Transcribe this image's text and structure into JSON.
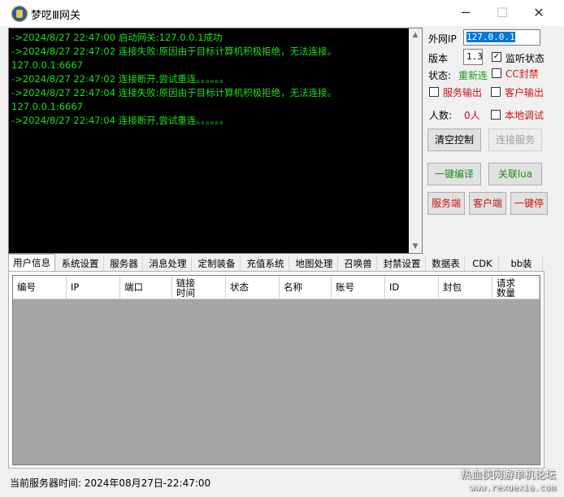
{
  "window": {
    "title": "梦呓Ⅲ网关",
    "minimize": "─",
    "maximize": "☐",
    "close": "✕"
  },
  "log": [
    "->2024/8/27 22:47:00   启动网关:127.0.0.1成功",
    "->2024/8/27 22:47:02   连接失败:原因由于目标计算机积极拒绝，无法连接。",
    "127.0.0.1:6667",
    "->2024/8/27 22:47:02   连接断开,尝试重连。。。。。。",
    "->2024/8/27 22:47:04   连接失败:原因由于目标计算机积极拒绝，无法连接。",
    "127.0.0.1:6667",
    "->2024/8/27 22:47:04   连接断开,尝试重连。。。。。。"
  ],
  "side": {
    "ip_label": "外网IP",
    "ip_value": "127.0.0.1",
    "version_label": "版本",
    "version_value": "1.3",
    "monitor_label": "监听状态",
    "status_label": "状态:",
    "status_value": "重新连",
    "cc_label": "CC封禁",
    "server_output_label": "服务输出",
    "client_output_label": "客户输出",
    "count_label": "人数:",
    "count_value": "0人",
    "local_debug_label": "本地调试",
    "btn_clear": "清空控制",
    "btn_connect": "连接服务",
    "btn_compile": "一键编译",
    "btn_link_lua": "关联lua",
    "btn_server": "服务端",
    "btn_client": "客户端",
    "btn_stop": "一键停"
  },
  "checks": {
    "monitor": true,
    "cc": false,
    "server_output": false,
    "client_output": false,
    "local_debug": false
  },
  "tabs": [
    "用户信息",
    "系统设置",
    "服务器",
    "消息处理",
    "定制装备",
    "充值系统",
    "地图处理",
    "召唤兽",
    "封禁设置",
    "数据表",
    "CDK",
    "bb装"
  ],
  "columns": [
    "编号",
    "IP",
    "端口",
    "链接时间",
    "状态",
    "名称",
    "账号",
    "ID",
    "封包",
    "请求数量"
  ],
  "statusbar": "当前服务器时间:  2024年08月27日-22:47:00",
  "watermark": {
    "line1": "热血侠网游单机论坛",
    "line2": "www.rexuexia.com"
  },
  "colors": {
    "log_text": "#1ee01e",
    "console_bg": "#000000",
    "status_green": "#1a9a1a",
    "cc_red": "#d01010",
    "count_red": "#d01010",
    "compile_green": "#1a8c1a",
    "red_button_text": "#c81414"
  }
}
